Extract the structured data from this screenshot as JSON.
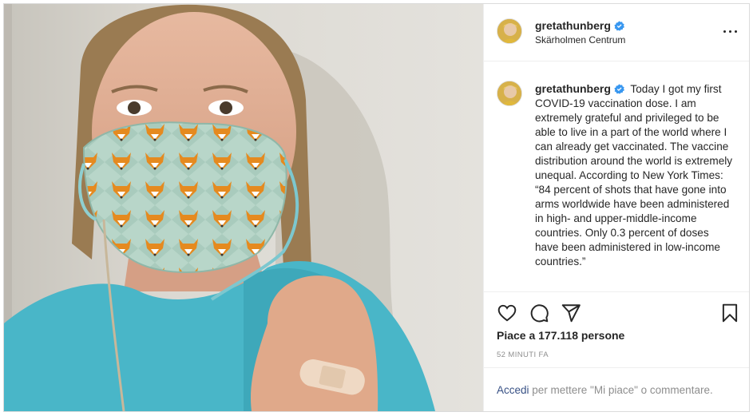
{
  "post": {
    "username": "gretathunberg",
    "location": "Skärholmen Centrum",
    "caption": "Today I got my first COVID-19 vaccination dose. I am extremely grateful and privileged to be able to live in a part of the world where I can already get vaccinated. The vaccine distribution around the world is extremely unequal. According to New York Times: “84 percent of shots that have gone into arms worldwide have been administered in high- and upper-middle-income countries. Only 0.3 percent of doses have been administered in low-income countries.”",
    "likes": "Piace a 177.118 persone",
    "timestamp": "52 MINUTI FA"
  },
  "login": {
    "link": "Accedi",
    "text": " per mettere \"Mi piace\" o commentare."
  },
  "icons": {
    "verified": "verified-badge-icon",
    "more": "more-options-icon",
    "like": "heart-icon",
    "comment": "comment-icon",
    "share": "paper-plane-icon",
    "save": "bookmark-icon"
  },
  "colors": {
    "verified": "#3897f0",
    "link": "#385185",
    "muted": "#8e8e8e",
    "border": "#dbdbdb"
  }
}
